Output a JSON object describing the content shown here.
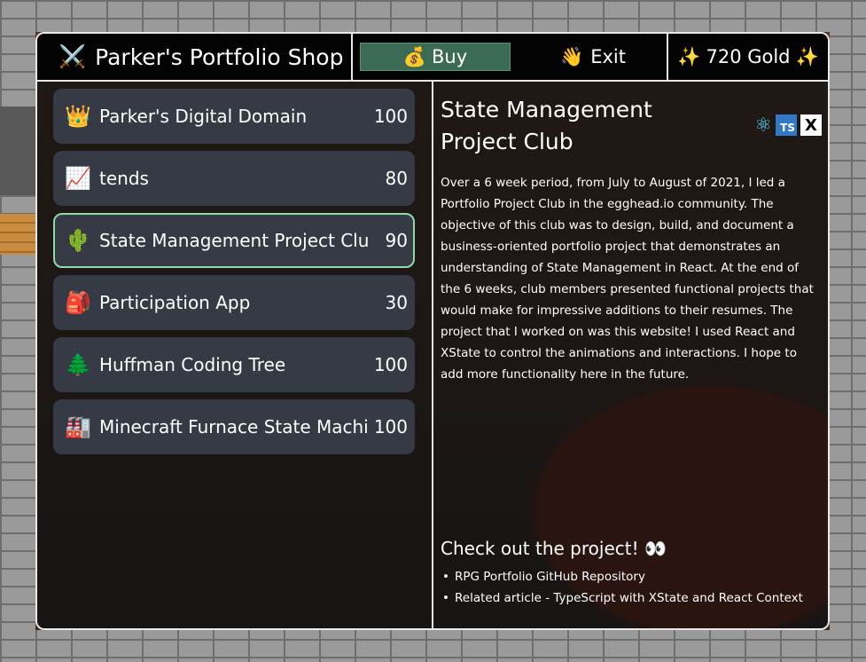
{
  "topbar": {
    "title_icon": "⚔️",
    "title": "Parker's Portfolio Shop",
    "buy_icon": "💰",
    "buy_label": "Buy",
    "exit_icon": "👋",
    "exit_label": "Exit",
    "gold_left": "✨",
    "gold_label": "720 Gold",
    "gold_right": "✨"
  },
  "items": [
    {
      "icon": "👑",
      "name": "Parker's Digital Domain",
      "price": "100"
    },
    {
      "icon": "📈",
      "name": "tends",
      "price": "80"
    },
    {
      "icon": "🌵",
      "name": "State Management Project Club",
      "price": "90"
    },
    {
      "icon": "🎒",
      "name": "Participation App",
      "price": "30"
    },
    {
      "icon": "🌲",
      "name": "Huffman Coding Tree",
      "price": "100"
    },
    {
      "icon": "🏭",
      "name": "Minecraft Furnace State Machine",
      "price": "100"
    }
  ],
  "selected_index": 2,
  "detail": {
    "title": "State Management Project Club",
    "tech": [
      "react-icon",
      "typescript-icon",
      "xstate-icon"
    ],
    "ts_label": "TS",
    "x_label": "X",
    "description": "Over a 6 week period, from July to August of 2021, I led a Portfolio Project Club in the egghead.io community. The objective of this club was to design, build, and document a business-oriented portfolio project that demonstrates an understanding of State Management in React. At the end of the 6 weeks, club members presented functional projects that would make for impressive additions to their resumes. The project that I worked on was this website! I used React and XState to control the animations and interactions. I hope to add more functionality here in the future.",
    "check_title": "Check out the project! 👀",
    "links": [
      "RPG Portfolio GitHub Repository",
      "Related article - TypeScript with XState and React Context"
    ]
  },
  "colors": {
    "buy_bg": "#3b6b55",
    "item_bg": "#363a45",
    "selected_border": "#8fd9a8",
    "ts_blue": "#3178c6",
    "react_cyan": "#61dafb"
  }
}
